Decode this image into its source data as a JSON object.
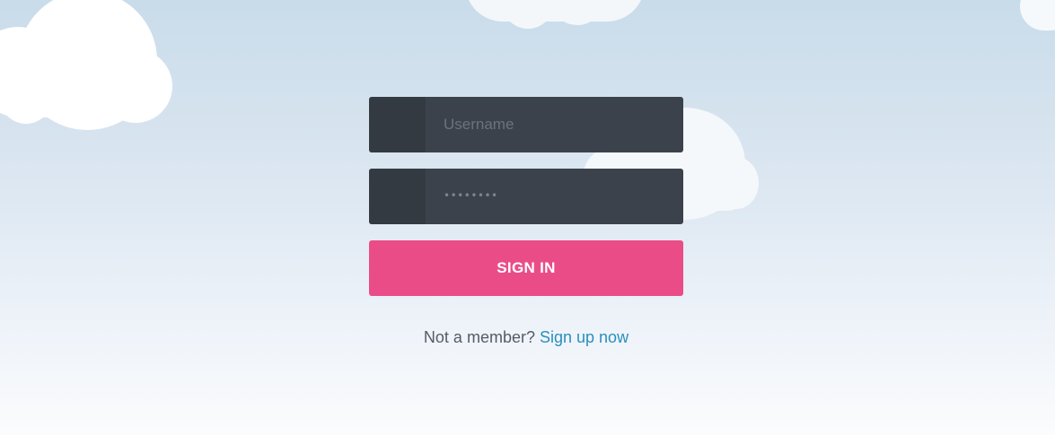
{
  "form": {
    "username_placeholder": "Username",
    "password_mask": "••••••••",
    "signin_label": "SIGN IN"
  },
  "signup": {
    "prompt": "Not a member?",
    "link_label": "Sign up now"
  },
  "colors": {
    "field_bg": "#3b424b",
    "field_icon_bg": "#343a41",
    "button_bg": "#ea4c88",
    "link": "#2a8fbd",
    "sky_top": "#c9dcea",
    "sky_bottom": "#fbfcfd"
  }
}
